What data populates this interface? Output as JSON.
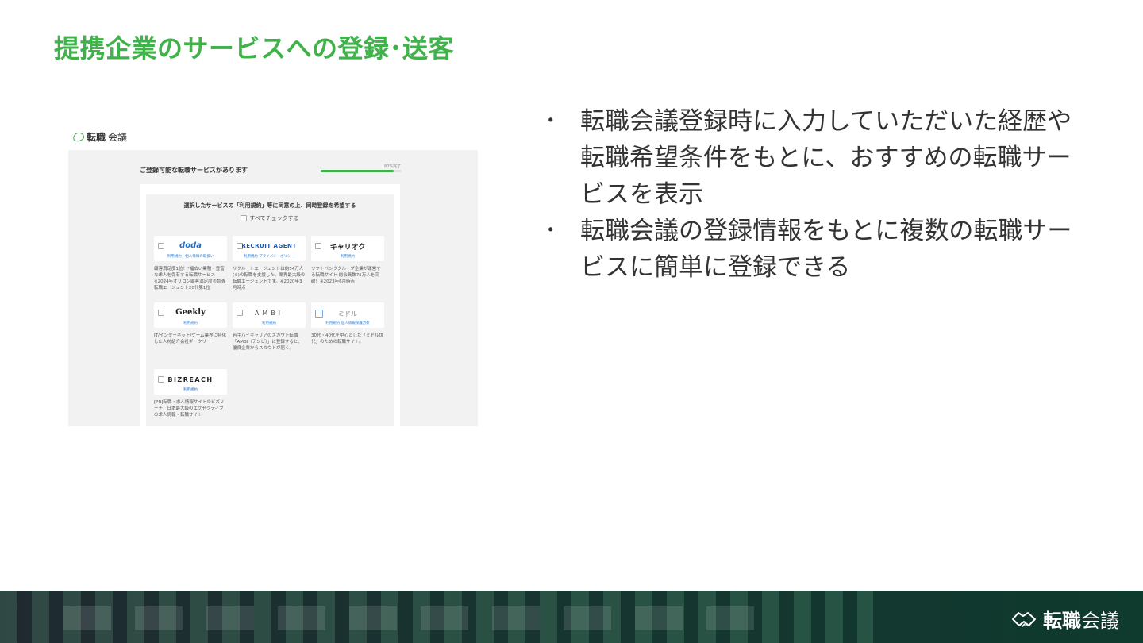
{
  "slide": {
    "title": "提携企業のサービスへの登録･送客"
  },
  "screenshot": {
    "logo_bold": "転職",
    "logo_light": "会議",
    "heading": "ご登録可能な転職サービスがあります",
    "progress_label": "80%完了",
    "progress_fraction": 0.9,
    "instruction": "選択したサービスの「利用規約」等に同意の上、同時登録を希望する",
    "check_all": "すべてチェックする",
    "services": [
      {
        "logo": "doda",
        "link": "利用規約・個人情報の取扱い",
        "desc": "顧客満足度1位！*幅広い業種・豊富な求人を保有する転職サービス ※2024年オリコン顧客満足度®調査 転職エージェント20代第1位"
      },
      {
        "logo": "RECRUIT AGENT",
        "link": "利用規約 プライバシーポリシー",
        "desc": "リクルートエージェントは約54万人(※)の転職を支援した、業界最大級の転職エージェントです。※2020年3月時点"
      },
      {
        "logo": "キャリオク",
        "link": "利用規約",
        "desc": "ソフトバンクグループ企業が運営する転職サイト 総会員数75万人を突破！※2023年6月時点"
      },
      {
        "logo": "Geekly",
        "link": "利用規約",
        "desc": "IT/インターネット/ゲーム業界に特化した人材紹介会社ギークリー"
      },
      {
        "logo": "AMBI",
        "link": "利用規約",
        "desc": "若手ハイキャリアのスカウト転職「AMBI（アンビ）」に登録すると、優良企業からスカウトが届く。"
      },
      {
        "logo": "ミドル",
        "link": "利用規約 個人情報保護方針",
        "desc": "30代・40代を中心とした「ミドル世代」のための転職サイト。"
      },
      {
        "logo": "BIZREACH",
        "link": "利用規約",
        "desc": "[PR]転職・求人情報サイトのビズリーチ　日本最大級のエグゼクティブの求人情報・転職サイト"
      }
    ]
  },
  "bullets": [
    "転職会議登録時に入力していただいた経歴や転職希望条件をもとに、おすすめの転職サービスを表示",
    "転職会議の登録情報をもとに複数の転職サービスに簡単に登録できる"
  ],
  "bullet_marker": "･",
  "footer": {
    "logo_bold": "転職",
    "logo_light": "会議",
    "icon": "handshake-icon"
  },
  "colors": {
    "brand_green": "#3fb24a",
    "footer_dark": "#173430"
  }
}
